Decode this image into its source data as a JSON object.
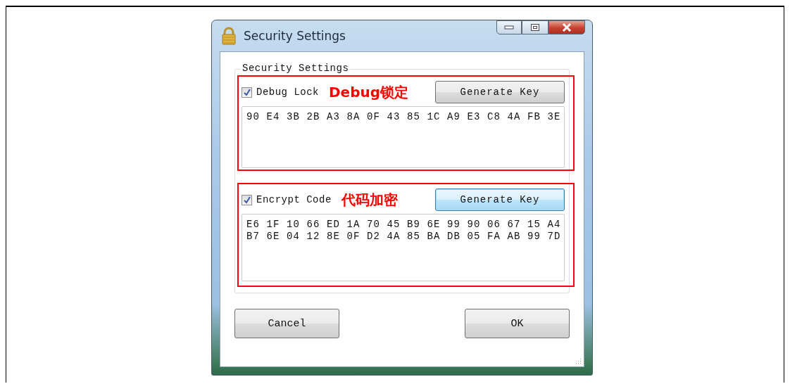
{
  "window": {
    "title": "Security Settings"
  },
  "group": {
    "label": "Security Settings"
  },
  "sections": [
    {
      "checkbox": {
        "label": "Debug Lock",
        "checked": true
      },
      "annotation": "Debug锁定",
      "button": {
        "label": "Generate Key",
        "focused": false
      },
      "key_lines": [
        "90 E4 3B 2B A3 8A 0F 43 85 1C A9 E3 C8 4A FB 3E"
      ]
    },
    {
      "checkbox": {
        "label": "Encrypt Code",
        "checked": true
      },
      "annotation": "代码加密",
      "button": {
        "label": "Generate Key",
        "focused": true
      },
      "key_lines": [
        "E6 1F 10 66 ED 1A 70 45 B9 6E 99 90 06 67 15 A4",
        "B7 6E 04 12 8E 0F D2 4A 85 BA DB 05 FA AB 99 7D"
      ]
    }
  ],
  "buttons": [
    {
      "label": "Cancel"
    },
    {
      "label": "OK"
    }
  ]
}
